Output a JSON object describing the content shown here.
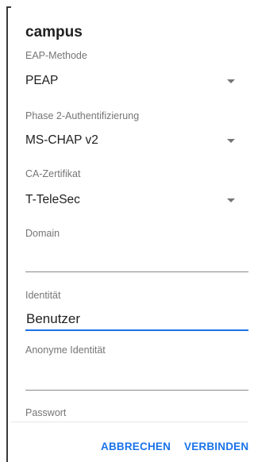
{
  "dialog": {
    "title": "campus",
    "eap_method": {
      "label": "EAP-Methode",
      "value": "PEAP"
    },
    "phase2": {
      "label": "Phase 2-Authentifizierung",
      "value": "MS-CHAP v2"
    },
    "ca_cert": {
      "label": "CA-Zertifikat",
      "value": "T-TeleSec"
    },
    "domain": {
      "label": "Domain",
      "value": ""
    },
    "identity": {
      "label": "Identität",
      "value": "Benutzer"
    },
    "anonymous_identity": {
      "label": "Anonyme Identität",
      "value": ""
    },
    "password": {
      "label": "Passwort"
    }
  },
  "actions": {
    "cancel": "ABBRECHEN",
    "connect": "VERBINDEN"
  },
  "colors": {
    "accent": "#1a73e8",
    "label": "#757575",
    "text": "#212121"
  },
  "icons": {
    "dropdown": "dropdown-arrow-icon"
  }
}
